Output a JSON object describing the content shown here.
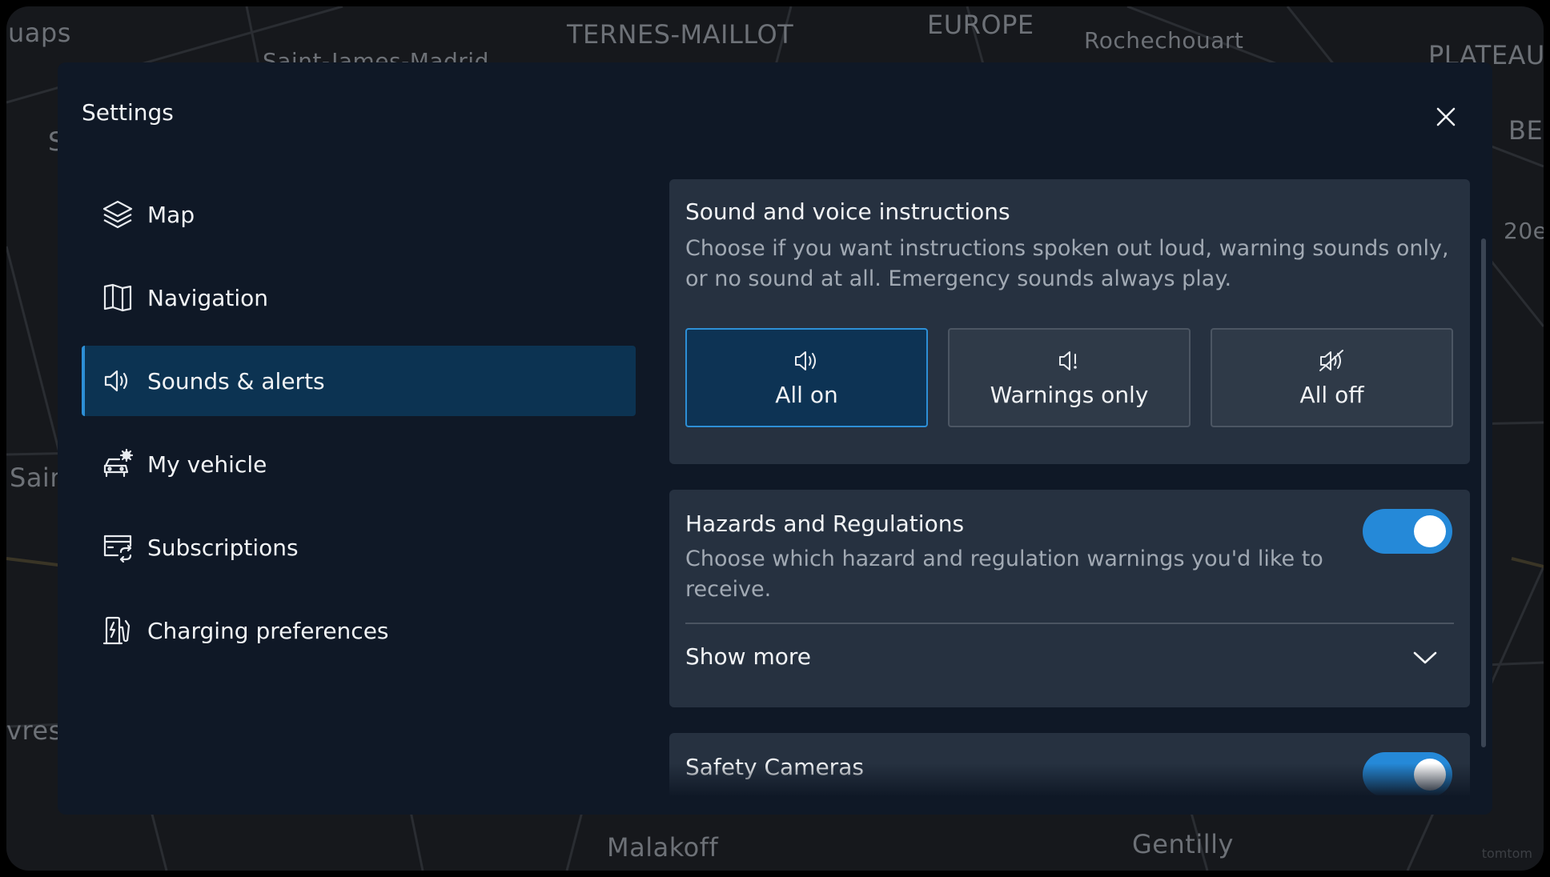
{
  "map": {
    "labels": [
      "uaps",
      "TERNES-MAILLOT",
      "Saint-James-Madrid",
      "EUROPE",
      "Rochechouart",
      "PLATEAU",
      "BEI",
      "20e",
      "Sair",
      "vres",
      "Malakoff",
      "Gentilly",
      "S"
    ],
    "watermark": "tomtom"
  },
  "settings": {
    "title": "Settings",
    "close_icon": "close-icon"
  },
  "sidebar": {
    "items": [
      {
        "label": "Map",
        "icon": "layers-icon",
        "active": false
      },
      {
        "label": "Navigation",
        "icon": "map-folded-icon",
        "active": false
      },
      {
        "label": "Sounds & alerts",
        "icon": "speaker-icon",
        "active": true
      },
      {
        "label": "My vehicle",
        "icon": "vehicle-gear-icon",
        "active": false
      },
      {
        "label": "Subscriptions",
        "icon": "card-refresh-icon",
        "active": false
      },
      {
        "label": "Charging preferences",
        "icon": "charging-station-icon",
        "active": false
      }
    ]
  },
  "sound_voice": {
    "title": "Sound and voice instructions",
    "description": "Choose if you want instructions spoken out loud, warning sounds only, or no sound at all. Emergency sounds always play.",
    "options": [
      {
        "label": "All on",
        "icon": "speaker-on-icon",
        "selected": true
      },
      {
        "label": "Warnings only",
        "icon": "speaker-warning-icon",
        "selected": false
      },
      {
        "label": "All off",
        "icon": "speaker-muted-icon",
        "selected": false
      }
    ]
  },
  "hazards": {
    "title": "Hazards and Regulations",
    "description": "Choose which hazard and regulation warnings you'd like to receive.",
    "toggle_on": true,
    "show_more": "Show more"
  },
  "safety_cameras": {
    "title": "Safety Cameras",
    "toggle_on": true
  },
  "colors": {
    "accent": "#2589d8",
    "panel": "#0f1826",
    "card": "#263140",
    "selected": "#0d3354"
  }
}
